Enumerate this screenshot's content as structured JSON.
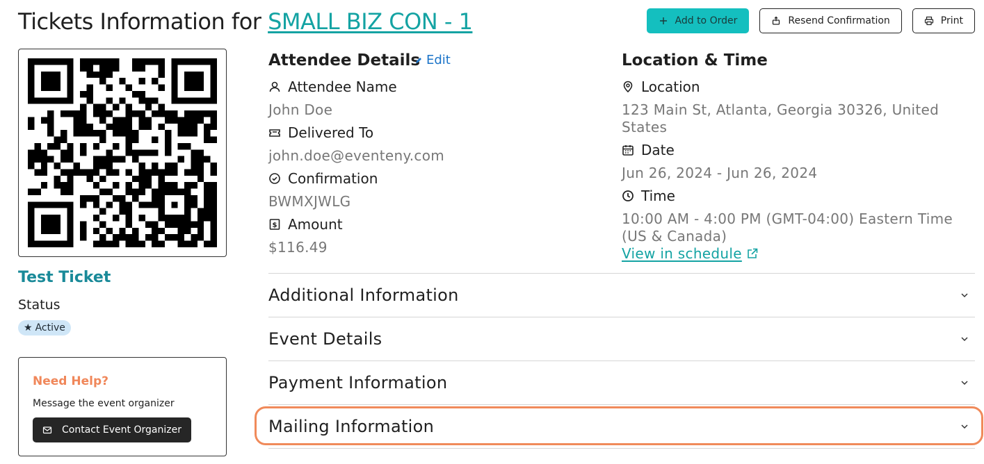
{
  "header": {
    "title_prefix": "Tickets Information for",
    "event_link": "SMALL BIZ CON - 1",
    "add_to_order": "Add to Order",
    "resend_confirmation": "Resend Confirmation",
    "print": "Print"
  },
  "ticket": {
    "name": "Test Ticket",
    "status_label": "Status",
    "status_value": "Active"
  },
  "help": {
    "title": "Need Help?",
    "message": "Message the event organizer",
    "contact_button": "Contact Event Organizer"
  },
  "attendee": {
    "section_title": "Attendee Details",
    "edit_label": "Edit",
    "name_label": "Attendee Name",
    "name_value": "John Doe",
    "delivered_label": "Delivered To",
    "delivered_value": "john.doe@eventeny.com",
    "confirmation_label": "Confirmation",
    "confirmation_value": "BWMXJWLG",
    "amount_label": "Amount",
    "amount_value": "$116.49"
  },
  "location_time": {
    "section_title": "Location & Time",
    "location_label": "Location",
    "location_value": "123 Main St, Atlanta, Georgia 30326, United States",
    "date_label": "Date",
    "date_value": "Jun 26, 2024 - Jun 26, 2024",
    "time_label": "Time",
    "time_value": "10:00 AM - 4:00 PM (GMT-04:00) Eastern Time (US & Canada)",
    "schedule_link": "View in schedule"
  },
  "accordions": [
    {
      "title": "Additional Information"
    },
    {
      "title": "Event Details"
    },
    {
      "title": "Payment Information"
    },
    {
      "title": "Mailing Information"
    }
  ],
  "colors": {
    "accent_teal": "#14bfbf",
    "link_teal": "#14a3a3",
    "ticket_name": "#1a8a99",
    "help_title": "#f0875a",
    "highlight": "#f08a5a",
    "badge_bg": "#cfe6f7"
  },
  "icons": {
    "add": "plus-icon",
    "resend": "send-icon",
    "print": "printer-icon",
    "edit": "pencil-icon",
    "name": "user-icon",
    "delivered": "ticket-icon",
    "confirmation": "check-circle-icon",
    "amount": "dollar-doc-icon",
    "location": "map-pin-icon",
    "date": "calendar-icon",
    "time": "clock-icon",
    "external": "external-link-icon",
    "chevron": "chevron-down-icon",
    "status": "star-icon",
    "contact": "mail-icon"
  }
}
